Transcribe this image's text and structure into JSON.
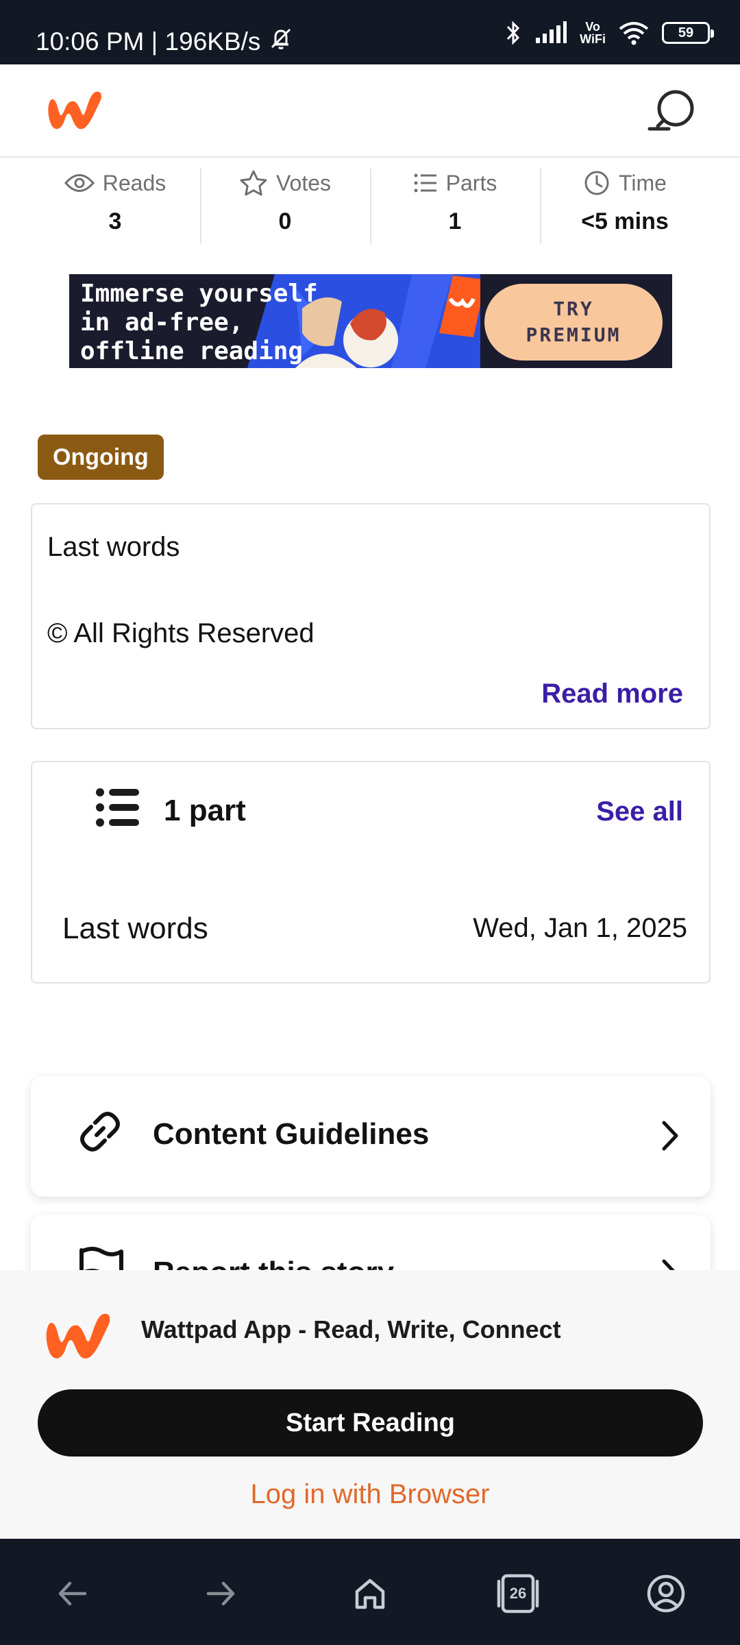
{
  "status_bar": {
    "time_speed": "10:06 PM | 196KB/s",
    "vowifi_top": "Vo",
    "vowifi_bottom": "WiFi",
    "battery": "59"
  },
  "header": {
    "logo_icon": "wattpad-logo-icon",
    "search_icon": "search-icon"
  },
  "stats": [
    {
      "label": "Reads",
      "value": "3",
      "icon": "eye-icon"
    },
    {
      "label": "Votes",
      "value": "0",
      "icon": "star-icon"
    },
    {
      "label": "Parts",
      "value": "1",
      "icon": "list-icon"
    },
    {
      "label": "Time",
      "value": "<5 mins",
      "icon": "clock-icon"
    }
  ],
  "banner": {
    "text": "Immerse yourself\nin ad-free,\noffline reading",
    "cta_line1": "TRY",
    "cta_line2": "PREMIUM"
  },
  "story": {
    "status": "Ongoing",
    "description": "Last words",
    "rights": "© All Rights Reserved",
    "read_more": "Read more"
  },
  "parts": {
    "title": "1 part",
    "see_all": "See all",
    "items": [
      {
        "name": "Last words",
        "date": "Wed, Jan 1, 2025"
      }
    ]
  },
  "links": {
    "guidelines": "Content Guidelines",
    "report": "Report this story"
  },
  "app_sheet": {
    "title": "Wattpad App - Read, Write, Connect",
    "start_button": "Start Reading",
    "login_link": "Log in with Browser"
  },
  "browser_nav": {
    "tab_count": "26"
  },
  "colors": {
    "brand_orange": "#ff6122",
    "link_purple": "#3a1ea6",
    "ongoing_badge": "#8b5a12",
    "login_orange": "#e0692b",
    "system_bar": "#121824"
  }
}
